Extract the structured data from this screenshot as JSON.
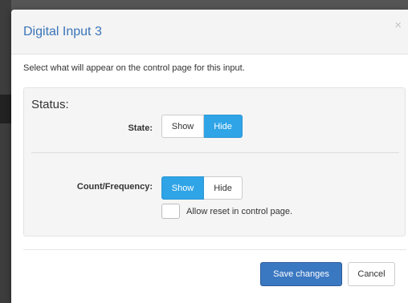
{
  "modal": {
    "title": "Digital Input 3",
    "close_icon": "×"
  },
  "intro_text": "Select what will appear on the control page for this input.",
  "status": {
    "heading": "Status:",
    "state": {
      "label": "State:",
      "options": [
        "Show",
        "Hide"
      ],
      "selected": "Hide"
    },
    "count_frequency": {
      "label": "Count/Frequency:",
      "options": [
        "Show",
        "Hide"
      ],
      "selected": "Show"
    },
    "allow_reset": {
      "label": "Allow reset in control page.",
      "checked": false
    }
  },
  "footer": {
    "save_label": "Save changes",
    "cancel_label": "Cancel"
  },
  "colors": {
    "accent_active": "#2fa4e7",
    "primary_button": "#3b78c2",
    "title_color": "#3a74b8"
  },
  "icons": {
    "close": "close-icon",
    "checkbox": "checkbox-icon"
  }
}
